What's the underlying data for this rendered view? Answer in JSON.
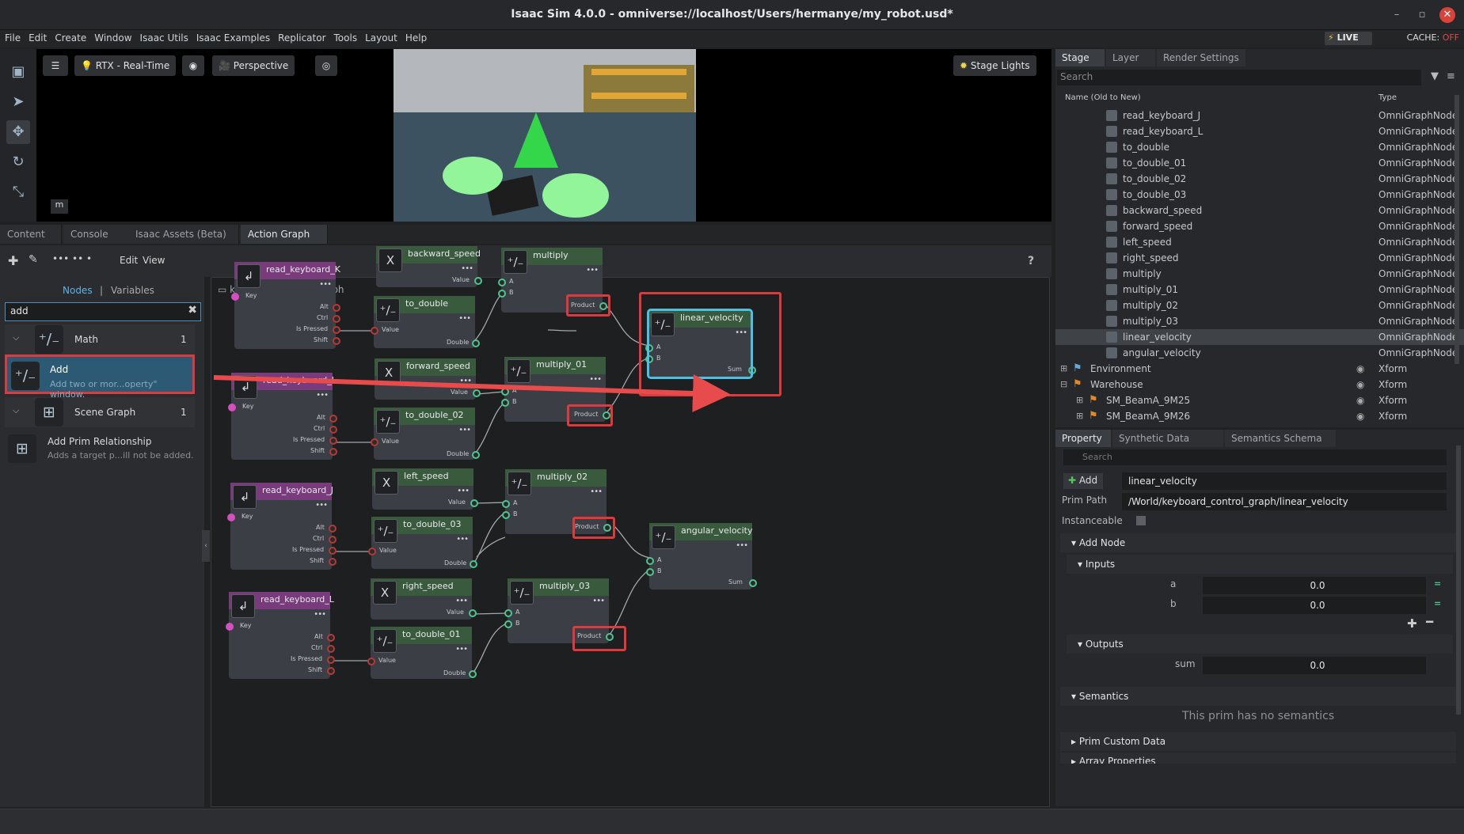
{
  "window": {
    "title": "Isaac Sim 4.0.0 - omniverse://localhost/Users/hermanye/my_robot.usd*"
  },
  "menu": [
    "File",
    "Edit",
    "Create",
    "Window",
    "Isaac Utils",
    "Isaac Examples",
    "Replicator",
    "Tools",
    "Layout",
    "Help"
  ],
  "status": {
    "live": "LIVE",
    "cache_label": "CACHE:",
    "cache_value": "OFF"
  },
  "viewport": {
    "render_mode": "RTX - Real-Time",
    "camera": "Perspective",
    "lights": "Stage Lights",
    "m_label": "m"
  },
  "bottom_tabs": [
    "Content",
    "Console",
    "Isaac Assets (Beta)",
    "Action Graph"
  ],
  "action_graph": {
    "menu_edit": "Edit",
    "menu_view": "View",
    "help": "?",
    "subtabs": {
      "nodes": "Nodes",
      "sep": "|",
      "variables": "Variables"
    },
    "search_value": "add",
    "categories": [
      {
        "label": "Math",
        "count": "1"
      },
      {
        "label": "Scene Graph",
        "count": "1"
      }
    ],
    "results": [
      {
        "title": "Add",
        "desc": "Add two or mor...operty\" window."
      },
      {
        "title": "Add Prim Relationship",
        "desc": "Adds a target p...ill not be added."
      }
    ],
    "graph_name": "keyboard_control_graph",
    "keyboard_nodes": [
      {
        "title": "read_keyboard_K"
      },
      {
        "title": "read_keyboard_I"
      },
      {
        "title": "read_keyboard_J"
      },
      {
        "title": "read_keyboard_L"
      }
    ],
    "speed_nodes": [
      {
        "title": "backward_speed"
      },
      {
        "title": "forward_speed"
      },
      {
        "title": "left_speed"
      },
      {
        "title": "right_speed"
      }
    ],
    "double_nodes": [
      {
        "title": "to_double"
      },
      {
        "title": "to_double_02"
      },
      {
        "title": "to_double_03"
      },
      {
        "title": "to_double_01"
      }
    ],
    "multiply_nodes": [
      {
        "title": "multiply"
      },
      {
        "title": "multiply_01"
      },
      {
        "title": "multiply_02"
      },
      {
        "title": "multiply_03"
      }
    ],
    "add_nodes": [
      {
        "title": "linear_velocity"
      },
      {
        "title": "angular_velocity"
      }
    ],
    "pins": {
      "key": "Key",
      "alt": "Alt",
      "ctrl": "Ctrl",
      "pressed": "Is Pressed",
      "shift": "Shift",
      "value": "Value",
      "double": "Double",
      "a": "A",
      "b": "B",
      "product": "Product",
      "sum": "Sum"
    },
    "dots": "•••"
  },
  "stage": {
    "tabs": [
      "Stage",
      "Layer",
      "Render Settings"
    ],
    "search_placeholder": "Search",
    "col_name": "Name (Old to New)",
    "col_type": "Type",
    "rows": [
      {
        "name": "read_keyboard_J",
        "type": "OmniGraphNode"
      },
      {
        "name": "read_keyboard_L",
        "type": "OmniGraphNode"
      },
      {
        "name": "to_double",
        "type": "OmniGraphNode"
      },
      {
        "name": "to_double_01",
        "type": "OmniGraphNode"
      },
      {
        "name": "to_double_02",
        "type": "OmniGraphNode"
      },
      {
        "name": "to_double_03",
        "type": "OmniGraphNode"
      },
      {
        "name": "backward_speed",
        "type": "OmniGraphNode"
      },
      {
        "name": "forward_speed",
        "type": "OmniGraphNode"
      },
      {
        "name": "left_speed",
        "type": "OmniGraphNode"
      },
      {
        "name": "right_speed",
        "type": "OmniGraphNode"
      },
      {
        "name": "multiply",
        "type": "OmniGraphNode"
      },
      {
        "name": "multiply_01",
        "type": "OmniGraphNode"
      },
      {
        "name": "multiply_02",
        "type": "OmniGraphNode"
      },
      {
        "name": "multiply_03",
        "type": "OmniGraphNode"
      },
      {
        "name": "linear_velocity",
        "type": "OmniGraphNode"
      },
      {
        "name": "angular_velocity",
        "type": "OmniGraphNode"
      }
    ],
    "tree_rows": [
      {
        "name": "Environment",
        "type": "Xform"
      },
      {
        "name": "Warehouse",
        "type": "Xform"
      },
      {
        "name": "SM_BeamA_9M25",
        "type": "Xform"
      },
      {
        "name": "SM_BeamA_9M26",
        "type": "Xform"
      }
    ]
  },
  "property": {
    "tabs": [
      "Property",
      "Synthetic Data Recorder",
      "Semantics Schema Editor"
    ],
    "search_placeholder": "Search",
    "add_label": "Add",
    "name_value": "linear_velocity",
    "prim_path_label": "Prim Path",
    "prim_path": "/World/keyboard_control_graph/linear_velocity",
    "instanceable_label": "Instanceable",
    "sections": {
      "add_node": "Add Node",
      "inputs": "Inputs",
      "outputs": "Outputs",
      "semantics": "Semantics",
      "custom": "Prim Custom Data",
      "array": "Array Properties"
    },
    "inputs": [
      {
        "label": "a",
        "value": "0.0"
      },
      {
        "label": "b",
        "value": "0.0"
      }
    ],
    "outputs": [
      {
        "label": "sum",
        "value": "0.0"
      }
    ],
    "semantics_empty": "This prim has no semantics"
  }
}
